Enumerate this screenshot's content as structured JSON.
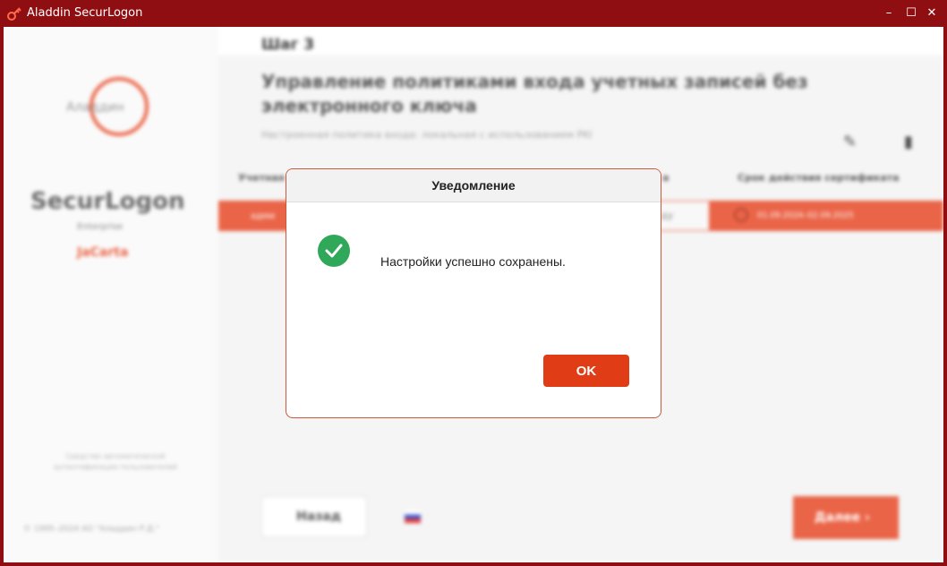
{
  "window": {
    "title": "Aladdin SecurLogon",
    "controls": {
      "minimize": "–",
      "maximize": "☐",
      "close": "✕"
    }
  },
  "sidebar": {
    "logo_text": "Аладдин",
    "product": "SecurLogon",
    "edition": "Enterprise",
    "brand": "JaCarta",
    "note": "Средство автоматической аутентификации пользователей",
    "copyright": "© 1995–2024 АО \"Аладдин Р.Д.\""
  },
  "main": {
    "step": "Шаг 3",
    "heading": "Управление политиками входа учетных записей без электронного ключа",
    "subtitle": "Настроенная политика входа: локальная с использованием PKI",
    "columns": {
      "account": "Учетная",
      "policy": "а",
      "cert_validity": "Срок действия сертификата"
    },
    "row": {
      "account": "адми",
      "select_value": "ду",
      "cert_dates": "01.09.2024–02.09.2025"
    },
    "back_label": "Назад",
    "next_label": "Далее"
  },
  "dialog": {
    "title": "Уведомление",
    "message": "Настройки успешно сохранены.",
    "ok_label": "OK"
  },
  "colors": {
    "titlebar": "#8f0e12",
    "accent": "#e03d17",
    "success": "#2fa85a"
  }
}
